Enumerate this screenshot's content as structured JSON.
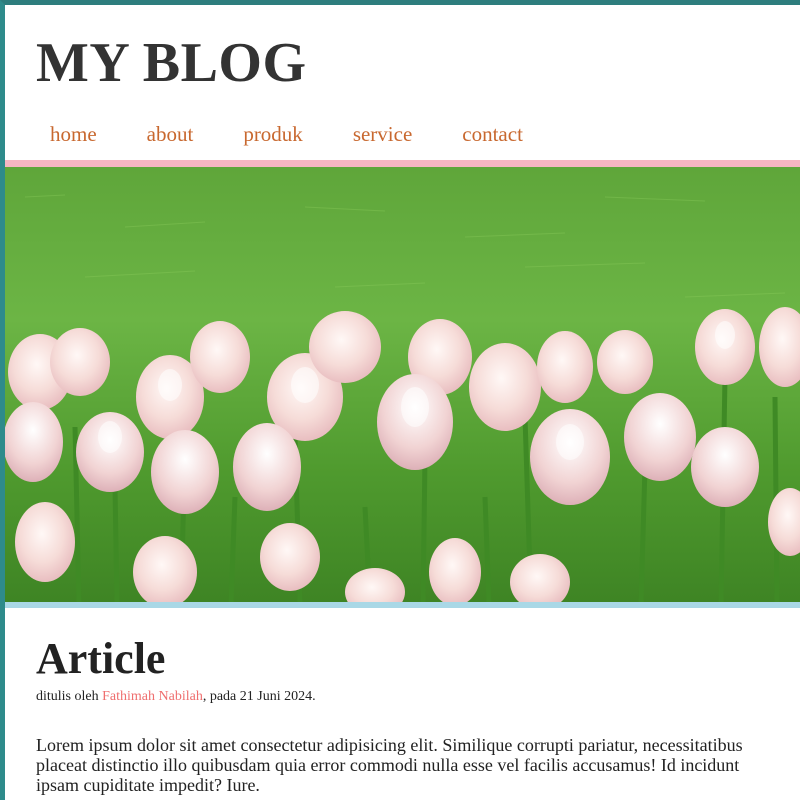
{
  "header": {
    "title": "MY BLOG"
  },
  "nav": {
    "items": [
      {
        "label": "home"
      },
      {
        "label": "about"
      },
      {
        "label": "produk"
      },
      {
        "label": "service"
      },
      {
        "label": "contact"
      }
    ]
  },
  "hero": {
    "image": "tulip-field-photo"
  },
  "article": {
    "title": "Article",
    "meta_prefix": "ditulis oleh ",
    "author": "Fathimah Nabilah",
    "meta_suffix": ", pada 21 Juni 2024.",
    "body_lines": [
      "Lorem ipsum dolor sit amet consectetur adipisicing elit. Similique corrupti pariatur, necessitatibus",
      "placeat distinctio illo quibusdam quia error commodi nulla esse vel facilis accusamus! Id incidunt",
      "ipsam cupiditate impedit? Iure."
    ]
  },
  "colors": {
    "frame_border": "#2e8b8b",
    "nav_link": "#c8682f",
    "pink_bar": "#f6b6c2",
    "blue_bar": "#a9d8e6",
    "author_link": "#ef6f6f"
  }
}
